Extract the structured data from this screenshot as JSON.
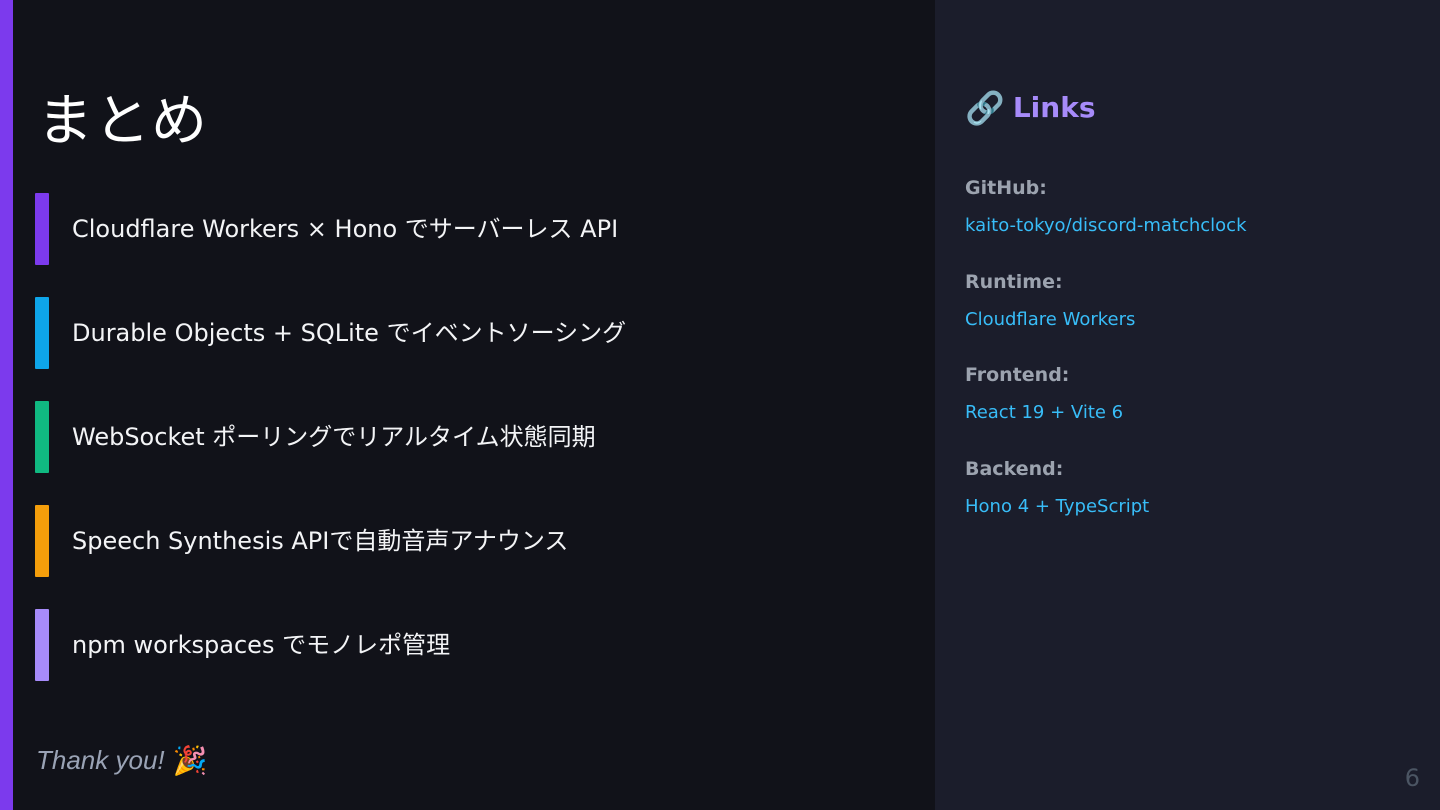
{
  "slide": {
    "title": "まとめ",
    "bullets": [
      {
        "text": "Cloudflare Workers × Hono でサーバーレス API",
        "color": "#7c3aed"
      },
      {
        "text": "Durable Objects + SQLite でイベントソーシング",
        "color": "#0ea5e9"
      },
      {
        "text": "WebSocket ポーリングでリアルタイム状態同期",
        "color": "#10b981"
      },
      {
        "text": "Speech Synthesis APIで自動音声アナウンス",
        "color": "#f59e0b"
      },
      {
        "text": "npm workspaces でモノレポ管理",
        "color": "#a78bfa"
      }
    ],
    "thanks": "Thank you!",
    "thanks_icon": "🎉",
    "page_number": "6"
  },
  "sidebar": {
    "icon": "🔗",
    "title": "Links",
    "items": [
      {
        "label": "GitHub:",
        "value": "kaito-tokyo/discord-matchclock"
      },
      {
        "label": "Runtime:",
        "value": "Cloudflare Workers"
      },
      {
        "label": "Frontend:",
        "value": "React 19 + Vite 6"
      },
      {
        "label": "Backend:",
        "value": "Hono 4 + TypeScript"
      }
    ]
  },
  "colors": {
    "accent": "#7c3aed",
    "background": "#111219",
    "sidebar_background": "#1b1d2b",
    "link": "#38bdf8",
    "heading_link": "#a78bfa"
  }
}
